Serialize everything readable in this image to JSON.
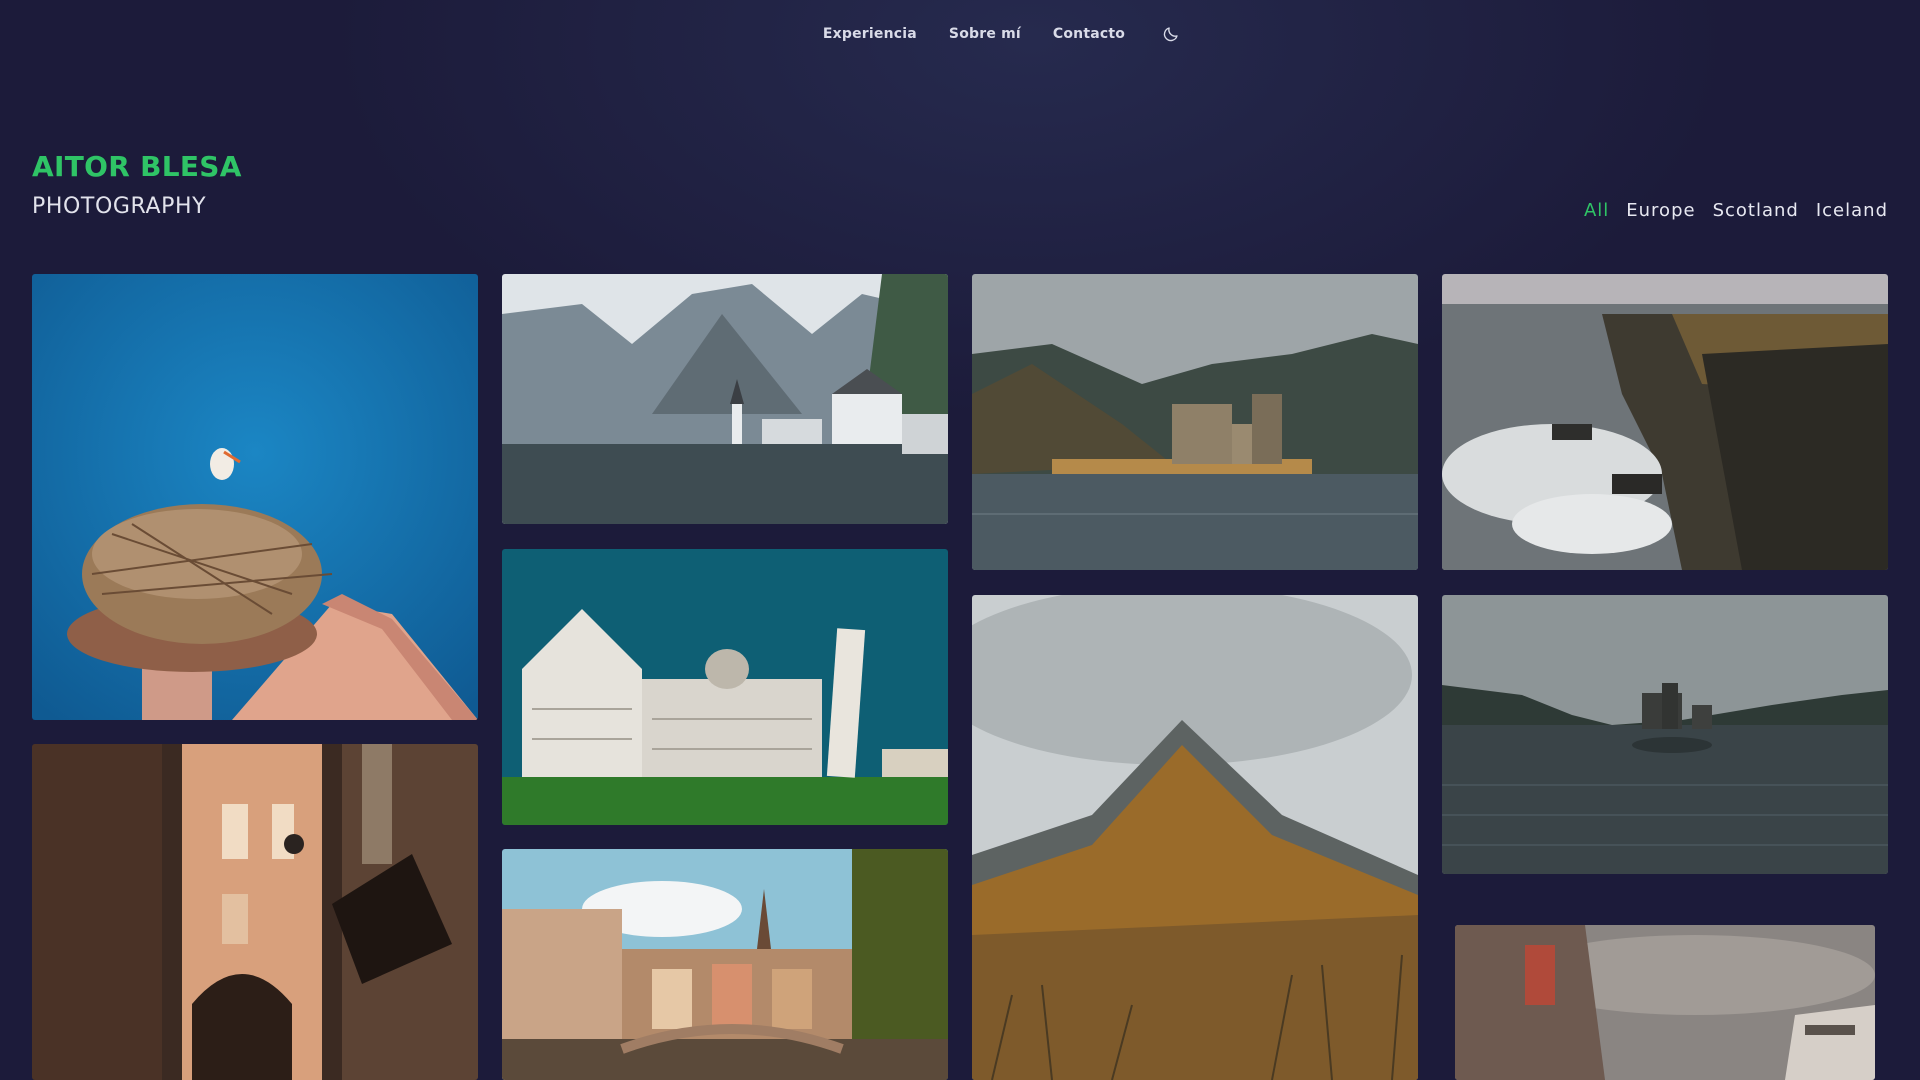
{
  "nav": {
    "items": [
      {
        "label": "Experiencia"
      },
      {
        "label": "Sobre mí"
      },
      {
        "label": "Contacto"
      }
    ],
    "theme_icon": "moon-icon"
  },
  "brand": {
    "name": "AITOR BLESA",
    "subtitle": "PHOTOGRAPHY"
  },
  "filters": {
    "items": [
      {
        "label": "All",
        "active": true
      },
      {
        "label": "Europe",
        "active": false
      },
      {
        "label": "Scotland",
        "active": false
      },
      {
        "label": "Iceland",
        "active": false
      }
    ]
  },
  "colors": {
    "background": "#1c1b3a",
    "accent": "#2fc466",
    "text": "#e2e3ec"
  }
}
